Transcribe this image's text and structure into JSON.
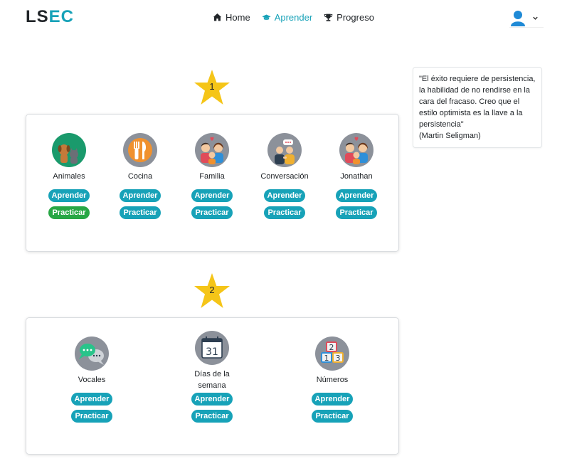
{
  "brand": {
    "part1": "LS",
    "part2": "EC"
  },
  "nav": {
    "home": "Home",
    "learn": "Aprender",
    "progress": "Progreso"
  },
  "colors": {
    "accent": "#17a2b8",
    "green": "#28a745",
    "star": "#f5c518"
  },
  "levels": [
    {
      "number": "1",
      "topics": [
        {
          "label": "Animales",
          "learn": "Aprender",
          "practice": "Practicar",
          "icon": "pets-icon"
        },
        {
          "label": "Cocina",
          "learn": "Aprender",
          "practice": "Practicar",
          "icon": "kitchen-icon"
        },
        {
          "label": "Familia",
          "learn": "Aprender",
          "practice": "Practicar",
          "icon": "family-icon"
        },
        {
          "label": "Conversación",
          "learn": "Aprender",
          "practice": "Practicar",
          "icon": "conversation-icon"
        },
        {
          "label": "Jonathan",
          "learn": "Aprender",
          "practice": "Practicar",
          "icon": "family-icon"
        }
      ]
    },
    {
      "number": "2",
      "topics": [
        {
          "label": "Vocales",
          "learn": "Aprender",
          "practice": "Practicar",
          "icon": "chat-bubbles-icon"
        },
        {
          "label": "Días de la semana",
          "learn": "Aprender",
          "practice": "Practicar",
          "icon": "calendar-icon"
        },
        {
          "label": "Números",
          "learn": "Aprender",
          "practice": "Practicar",
          "icon": "number-blocks-icon"
        }
      ]
    }
  ],
  "calendar_day": "31",
  "number_blocks": [
    "2",
    "1",
    "3"
  ],
  "quote": {
    "text": "\"El éxito requiere de persistencia, la habilidad de no rendirse en la cara del fracaso. Creo que el estilo optimista es la llave a la persistencia\"",
    "author": "(Martin Seligman)"
  }
}
